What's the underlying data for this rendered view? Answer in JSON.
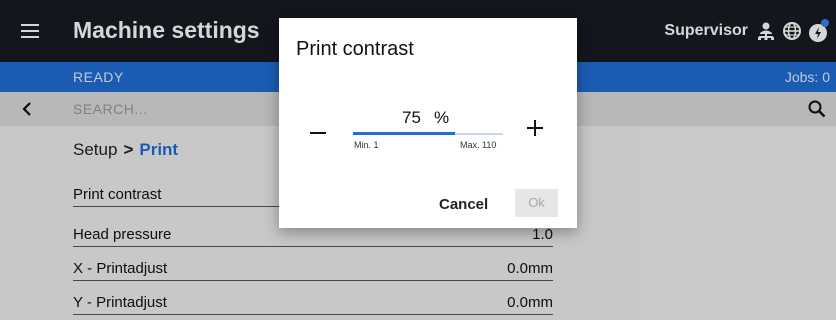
{
  "header": {
    "title": "Machine settings",
    "user_label": "Supervisor",
    "icons": [
      "user-network-icon",
      "globe-icon",
      "notification-icon"
    ]
  },
  "status": {
    "state": "READY",
    "jobs": "Jobs: 0"
  },
  "search": {
    "placeholder": "SEARCH..."
  },
  "breadcrumb": {
    "parent": "Setup",
    "separator": ">",
    "current": "Print"
  },
  "settings": [
    {
      "label": "Print contrast",
      "value": ""
    },
    {
      "label": "Head pressure",
      "value": "1.0"
    },
    {
      "label": "X - Printadjust",
      "value": "0.0mm"
    },
    {
      "label": "Y - Printadjust",
      "value": "0.0mm"
    }
  ],
  "dialog": {
    "title": "Print contrast",
    "value": "75",
    "unit": "%",
    "min_label": "Min. 1",
    "max_label": "Max. 110",
    "slider_fraction": 0.68,
    "cancel_label": "Cancel",
    "ok_label": "Ok"
  },
  "colors": {
    "header_bg": "#171b22",
    "status_bg": "#1f6ed6",
    "accent": "#1f6ed6"
  }
}
